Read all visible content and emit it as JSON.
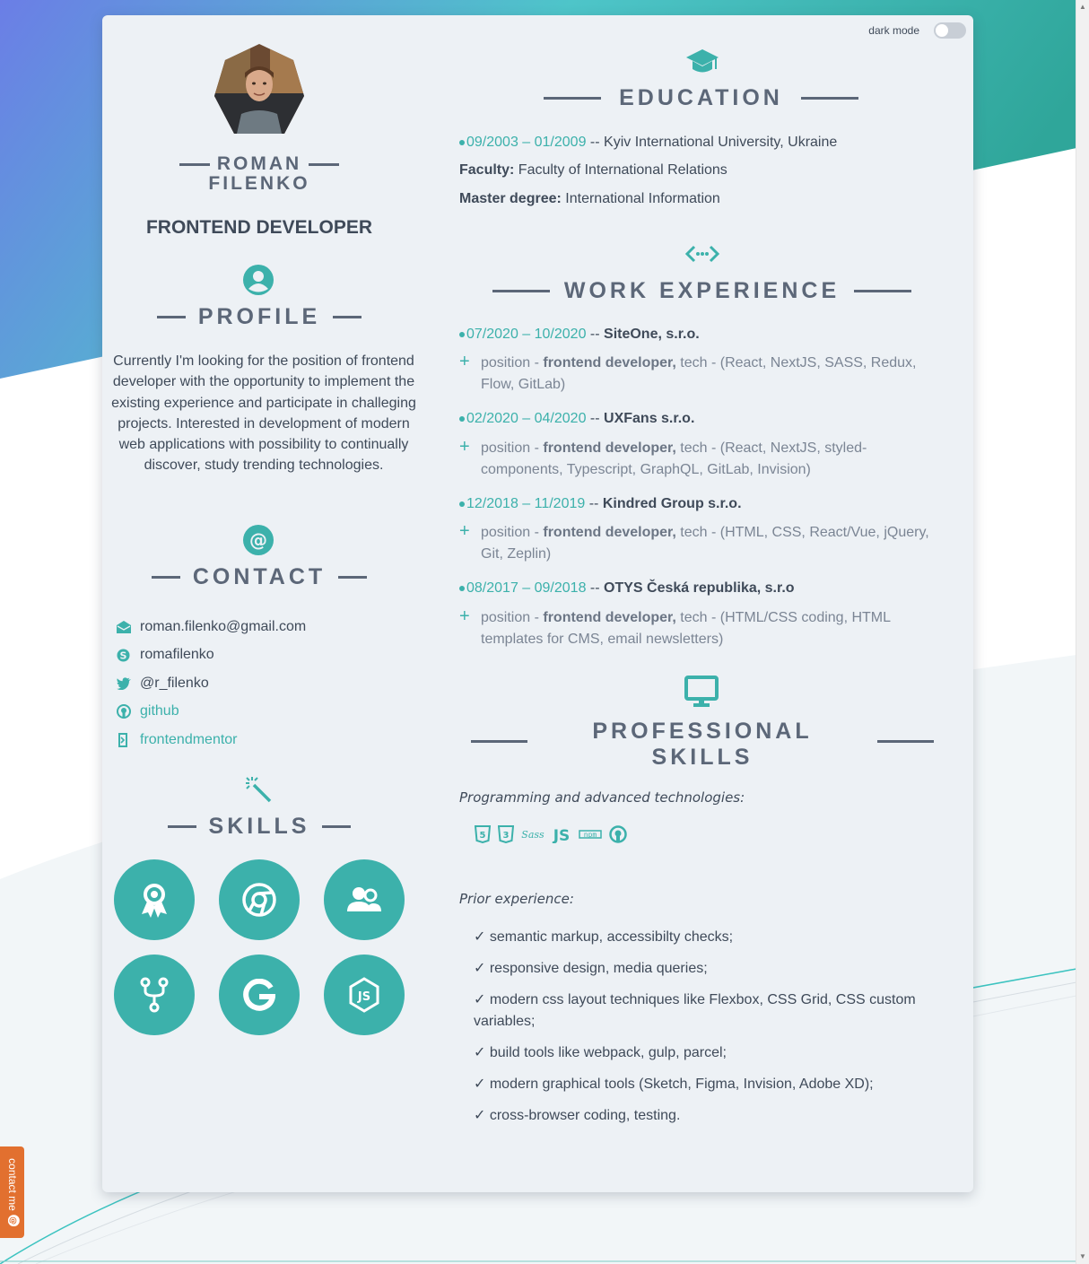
{
  "colors": {
    "accent": "#3cb1ab",
    "heading": "#5c6778",
    "text": "#3f4a59",
    "tab": "#e2702f"
  },
  "dark_mode": {
    "label": "dark mode",
    "enabled": false
  },
  "profile": {
    "first_name": "ROMAN",
    "last_name": "FILENKO",
    "role": "FRONTEND DEVELOPER"
  },
  "sections": {
    "profile": {
      "icon": "user-circle-icon",
      "title": "PROFILE"
    },
    "contact": {
      "icon": "at-sign-icon",
      "title": "CONTACT"
    },
    "skills": {
      "icon": "magic-wand-icon",
      "title": "SKILLS"
    },
    "education": {
      "icon": "graduation-cap-icon",
      "title": "EDUCATION"
    },
    "work": {
      "icon": "code-icon",
      "title": "WORK EXPERIENCE"
    },
    "professional": {
      "icon": "desktop-icon",
      "title_line1": "PROFESSIONAL",
      "title_line2": "SKILLS"
    }
  },
  "profile_text": "Currently I'm looking for the position of frontend developer with the opportunity to implement the existing experience and participate in challeging projects. Interested in development of modern web applications with possibility to continually discover, study trending technologies.",
  "contacts": [
    {
      "icon": "envelope-icon",
      "text": "roman.filenko@gmail.com",
      "link": false
    },
    {
      "icon": "skype-icon",
      "text": "romafilenko",
      "link": false
    },
    {
      "icon": "twitter-icon",
      "text": "@r_filenko",
      "link": false
    },
    {
      "icon": "github-icon",
      "text": "github",
      "link": true
    },
    {
      "icon": "frontendmentor-icon",
      "text": "frontendmentor",
      "link": true
    }
  ],
  "skill_icons": [
    "award-icon",
    "chrome-icon",
    "users-icon",
    "git-fork-icon",
    "google-icon",
    "nodejs-icon"
  ],
  "education": {
    "date": "09/2003 – 01/2009",
    "sep": " -- ",
    "place": "Kyiv International University, Ukraine",
    "faculty_label": "Faculty:",
    "faculty": " Faculty of International Relations",
    "degree_label": "Master degree:",
    "degree": " International Information"
  },
  "work": [
    {
      "date": "07/2020 – 10/2020",
      "company": "SiteOne, s.r.o.",
      "pos_label": "position - ",
      "position": "frontend developer,",
      "tech": " tech - (React, NextJS, SASS, Redux, Flow, GitLab)"
    },
    {
      "date": "02/2020 – 04/2020",
      "company": "UXFans s.r.o.",
      "pos_label": "position - ",
      "position": "frontend developer,",
      "tech": " tech - (React, NextJS, styled-components, Typescript, GraphQL, GitLab, Invision)"
    },
    {
      "date": "12/2018 – 11/2019",
      "company": "Kindred Group s.r.o.",
      "pos_label": "position - ",
      "position": "frontend developer,",
      "tech": " tech - (HTML, CSS, React/Vue, jQuery, Git, Zeplin)"
    },
    {
      "date": "08/2017 – 09/2018",
      "company": "OTYS Česká republika, s.r.o",
      "pos_label": "position - ",
      "position": "frontend developer,",
      "tech": " tech - (HTML/CSS coding, HTML templates for CMS, email newsletters)"
    }
  ],
  "work_sep": " -- ",
  "plus": "+",
  "programming_label": "Programming and advanced technologies:",
  "tech_icons": [
    "html5-icon",
    "css3-icon",
    "sass-icon",
    "js-icon",
    "npm-icon",
    "github-icon"
  ],
  "prior_label": "Prior experience:",
  "prior": [
    "✓ semantic markup, accessibilty checks;",
    "✓ responsive design, media queries;",
    "✓ modern css layout techniques like Flexbox, CSS Grid, CSS custom variables;",
    "✓ build tools like webpack, gulp, parcel;",
    "✓ modern graphical tools (Sketch, Figma, Invision, Adobe XD);",
    "✓ cross-browser coding, testing."
  ],
  "contact_tab": {
    "label": "contact me",
    "icon": "at-sign-icon"
  }
}
